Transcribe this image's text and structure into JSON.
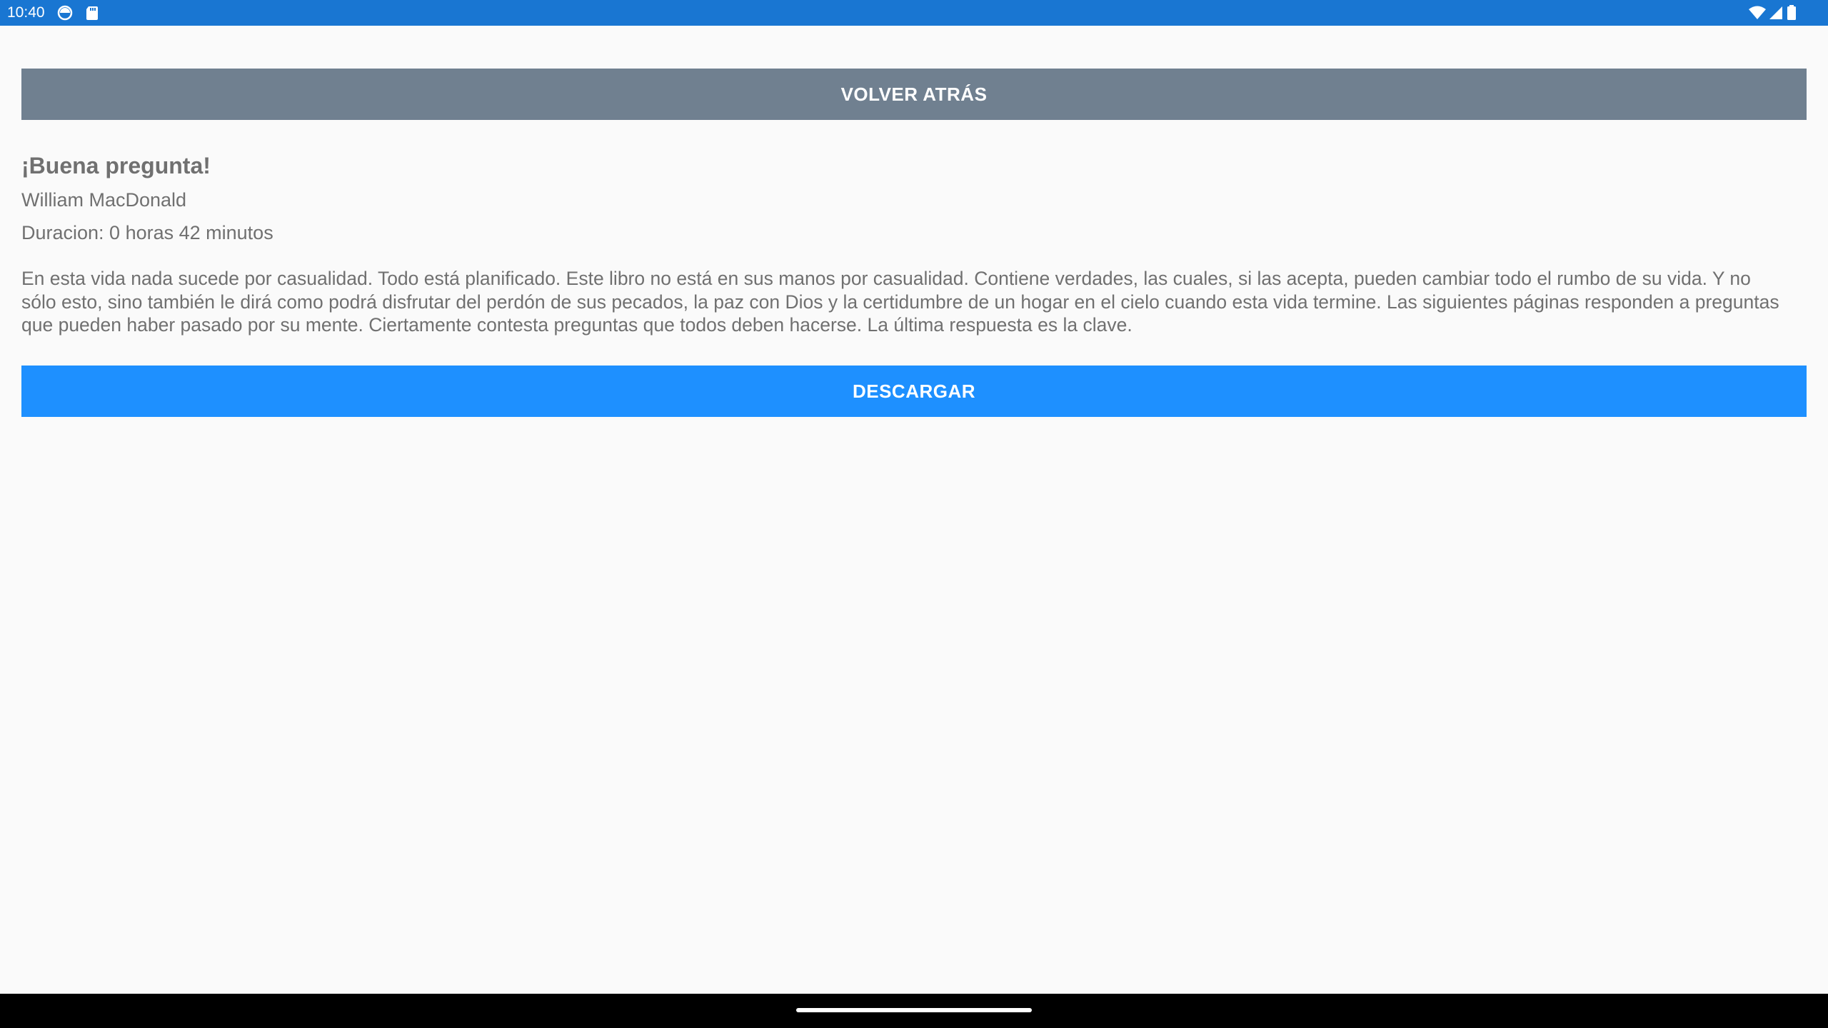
{
  "status_bar": {
    "time": "10:40",
    "left_icons": [
      "sync-icon",
      "sd-card-icon"
    ],
    "right_icons": [
      "wifi-icon",
      "cell-signal-icon",
      "battery-icon"
    ],
    "color": "#1976d2"
  },
  "actions": {
    "back_label": "VOLVER ATRÁS",
    "download_label": "DESCARGAR",
    "back_color": "#708090",
    "download_color": "#1e90ff"
  },
  "book": {
    "title": "¡Buena pregunta!",
    "author": "William MacDonald",
    "duration": "Duracion: 0 horas 42 minutos",
    "description": "En esta vida nada sucede por casualidad. Todo está planificado. Este libro no está en sus manos por casualidad. Contiene verdades, las cuales, si las acepta, pueden cambiar todo el rumbo de su vida. Y no sólo esto, sino también le dirá como podrá disfrutar del perdón de sus pecados, la paz con Dios y la certidumbre de un hogar en el cielo cuando esta vida termine. Las siguientes páginas responden a preguntas que pueden haber pasado por su mente. Ciertamente contesta preguntas que todos deben hacerse. La última respuesta es la clave."
  },
  "nav_bar": {
    "home_indicator": "home-gesture-bar"
  }
}
